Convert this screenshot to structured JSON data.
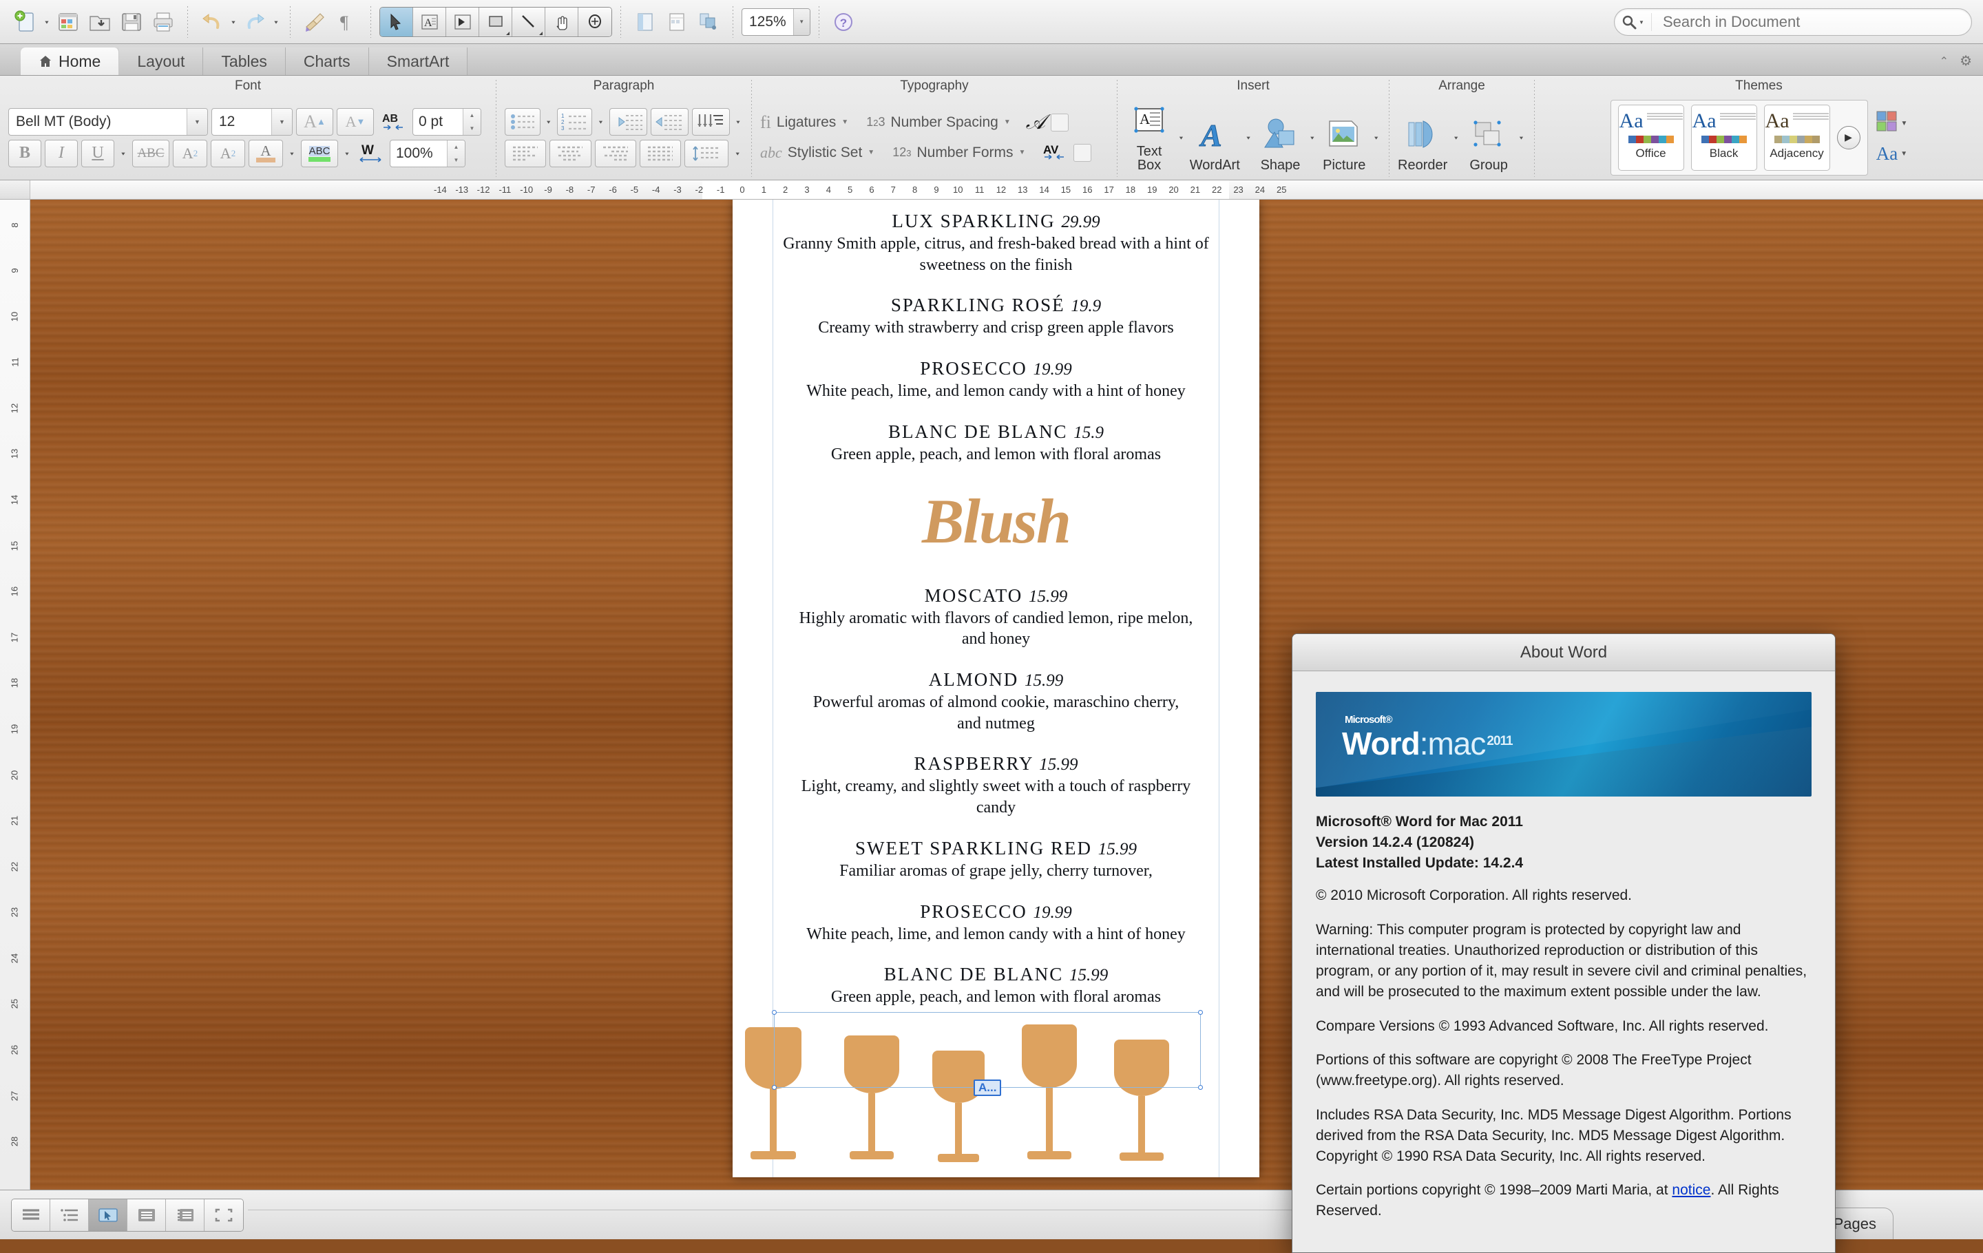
{
  "app": {
    "zoom_level": "125%",
    "search_placeholder": "Search in Document"
  },
  "toolbar": {
    "buttons": [
      {
        "name": "new-document",
        "label": "New"
      },
      {
        "name": "open-template-gallery",
        "label": "Template Gallery"
      },
      {
        "name": "open-document",
        "label": "Open"
      },
      {
        "name": "save-document",
        "label": "Save"
      },
      {
        "name": "print-document",
        "label": "Print"
      },
      {
        "name": "undo",
        "label": "Undo"
      },
      {
        "name": "redo",
        "label": "Redo"
      },
      {
        "name": "format-painter",
        "label": "Format"
      },
      {
        "name": "show-paragraph-marks",
        "label": "Show"
      }
    ],
    "mode_buttons": [
      {
        "name": "select-tool",
        "label": "Select",
        "active": true
      },
      {
        "name": "text-box-tool",
        "label": "Text Box",
        "active": false
      },
      {
        "name": "linked-text-box-tool",
        "label": "Linked Text Box",
        "active": false
      },
      {
        "name": "shape-tool",
        "label": "Shape",
        "active": false
      },
      {
        "name": "line-tool",
        "label": "Line",
        "active": false
      },
      {
        "name": "hand-tool",
        "label": "Hand",
        "active": false
      },
      {
        "name": "zoom-tool",
        "label": "Zoom",
        "active": false
      }
    ],
    "view_buttons": [
      {
        "name": "sidebar-toggle",
        "label": "Sidebar"
      },
      {
        "name": "show-guides",
        "label": "Guides"
      },
      {
        "name": "media-browser",
        "label": "Media"
      }
    ],
    "help_label": "Help"
  },
  "ribbon": {
    "tabs": [
      {
        "label": "Home",
        "icon": "home-icon",
        "active": true
      },
      {
        "label": "Layout",
        "icon": "",
        "active": false
      },
      {
        "label": "Tables",
        "icon": "",
        "active": false
      },
      {
        "label": "Charts",
        "icon": "",
        "active": false
      },
      {
        "label": "SmartArt",
        "icon": "",
        "active": false
      }
    ],
    "groups": {
      "font": {
        "title": "Font",
        "family": "Bell MT (Body)",
        "size": "12",
        "spacing": "0 pt",
        "scale": "100%",
        "buttons": [
          "grow-font",
          "shrink-font",
          "bold",
          "italic",
          "underline",
          "strikethrough",
          "superscript",
          "subscript",
          "font-color",
          "highlight"
        ]
      },
      "paragraph": {
        "title": "Paragraph",
        "buttons": [
          "bullets",
          "numbering",
          "decrease-indent",
          "increase-indent",
          "sort",
          "align-left",
          "align-center",
          "align-right",
          "justify",
          "line-spacing"
        ]
      },
      "typography": {
        "title": "Typography",
        "ligatures_label": "Ligatures",
        "number_spacing_label": "Number Spacing",
        "stylistic_set_label": "Stylistic Set",
        "number_forms_label": "Number Forms",
        "swash_label": "Swash",
        "kerning_label": "Kerning"
      },
      "insert": {
        "title": "Insert",
        "items": [
          {
            "label": "Text Box",
            "icon": "text-box-icon"
          },
          {
            "label": "WordArt",
            "icon": "wordart-icon"
          },
          {
            "label": "Shape",
            "icon": "shape-icon"
          },
          {
            "label": "Picture",
            "icon": "picture-icon"
          }
        ]
      },
      "arrange": {
        "title": "Arrange",
        "items": [
          {
            "label": "Reorder",
            "icon": "reorder-icon"
          },
          {
            "label": "Group",
            "icon": "group-icon"
          }
        ]
      },
      "themes": {
        "title": "Themes",
        "cards": [
          {
            "label": "Office",
            "aa_color": "#1f5aa0",
            "swatches": [
              "#3f72b5",
              "#c0392b",
              "#93b84a",
              "#7d519e",
              "#3aa5c4",
              "#e8973a"
            ]
          },
          {
            "label": "Black",
            "aa_color": "#1f5aa0",
            "swatches": [
              "#3f72b5",
              "#c0392b",
              "#93b84a",
              "#7d519e",
              "#3aa5c4",
              "#e8973a"
            ]
          },
          {
            "label": "Adjacency",
            "aa_color": "#4a3b23",
            "swatches": [
              "#b5a87a",
              "#9dc2cc",
              "#d6cf78",
              "#9aa3a6",
              "#c9a95e",
              "#b09b6a"
            ]
          }
        ],
        "colors_label": "Colors",
        "fonts_label": "Fonts"
      }
    }
  },
  "ruler": {
    "horizontal_ticks": [
      "-14",
      "-13",
      "-12",
      "-11",
      "-10",
      "-9",
      "-8",
      "-7",
      "-6",
      "-5",
      "-4",
      "-3",
      "-2",
      "-1",
      "0",
      "1",
      "2",
      "3",
      "4",
      "5",
      "6",
      "7",
      "8",
      "9",
      "10",
      "11",
      "12",
      "13",
      "14",
      "15",
      "16",
      "17",
      "18",
      "19",
      "20",
      "21",
      "22",
      "23",
      "24",
      "25"
    ],
    "vertical_ticks": [
      "8",
      "9",
      "10",
      "11",
      "12",
      "13",
      "14",
      "15",
      "16",
      "17",
      "18",
      "19",
      "20",
      "21",
      "22",
      "23",
      "24",
      "25",
      "26",
      "27",
      "28"
    ]
  },
  "document": {
    "sections": [
      {
        "heading": null,
        "items": [
          {
            "name": "LUX SPARKLING",
            "price": "29.99",
            "desc": "Granny Smith apple, citrus, and fresh-baked bread with a hint of sweetness on the finish"
          },
          {
            "name": "SPARKLING ROSÉ",
            "price": "19.9",
            "desc": "Creamy with strawberry and crisp green apple flavors"
          },
          {
            "name": "PROSECCO",
            "price": "19.99",
            "desc": "White peach, lime, and lemon candy with a hint of honey"
          },
          {
            "name": "BLANC DE BLANC",
            "price": "15.9",
            "desc": "Green apple, peach, and lemon with floral aromas"
          }
        ]
      },
      {
        "heading": "Blush",
        "items": [
          {
            "name": "MOSCATO",
            "price": "15.99",
            "desc": "Highly aromatic with flavors of candied lemon, ripe melon, and honey"
          },
          {
            "name": "ALMOND",
            "price": "15.99",
            "desc": "Powerful aromas of almond cookie, maraschino cherry, and nutmeg"
          },
          {
            "name": "RASPBERRY",
            "price": "15.99",
            "desc": "Light, creamy, and slightly sweet with a touch of raspberry candy"
          },
          {
            "name": "SWEET SPARKLING RED",
            "price": "15.99",
            "desc": "Familiar aromas of grape jelly, cherry turnover,"
          },
          {
            "name": "PROSECCO",
            "price": "19.99",
            "desc": "White peach, lime, and lemon candy with a hint of honey"
          },
          {
            "name": "BLANC DE BLANC",
            "price": "15.99",
            "desc": "Green apple, peach, and lemon with floral aromas"
          }
        ]
      }
    ],
    "selection_tag": "A...",
    "accent_color": "#d09a5f"
  },
  "about_dialog": {
    "title": "About Word",
    "banner": {
      "microsoft": "Microsoft®",
      "word": "Word",
      "mac": ":mac",
      "year": "2011"
    },
    "product": "Microsoft® Word for Mac 2011",
    "version": "Version 14.2.4 (120824)",
    "latest_update": "Latest Installed Update: 14.2.4",
    "copyright": "© 2010 Microsoft Corporation. All rights reserved.",
    "warning": "Warning: This computer program is protected by copyright law and international treaties.  Unauthorized reproduction or distribution of this program, or any portion of it, may result in severe civil and criminal penalties, and will be prosecuted to the maximum extent possible under the law.",
    "compare_versions": "Compare Versions © 1993 Advanced Software, Inc.  All rights reserved.",
    "freetype": "Portions of this software are copyright © 2008 The FreeType Project (www.freetype.org).  All rights reserved.",
    "rsa": "Includes RSA Data Security, Inc. MD5 Message Digest Algorithm. Portions derived from the RSA Data Security, Inc. MD5 Message Digest Algorithm.  Copyright © 1990 RSA Data Security, Inc. All rights reserved.",
    "marti_prefix": "Certain portions copyright © 1998–2009  Marti Maria, at ",
    "marti_link": "notice",
    "marti_suffix": ".  All Rights Reserved."
  },
  "status_bar": {
    "view_buttons": [
      {
        "name": "draft-view",
        "label": "Draft",
        "active": false
      },
      {
        "name": "outline-view",
        "label": "Outline",
        "active": false
      },
      {
        "name": "publishing-layout-view",
        "label": "Publishing Layout",
        "active": true
      },
      {
        "name": "print-layout-view",
        "label": "Print Layout",
        "active": false
      },
      {
        "name": "notebook-layout-view",
        "label": "Notebook Layout",
        "active": false
      },
      {
        "name": "full-screen-view",
        "label": "Full Screen",
        "active": false
      }
    ],
    "master_pages_label": "Master Pages"
  }
}
